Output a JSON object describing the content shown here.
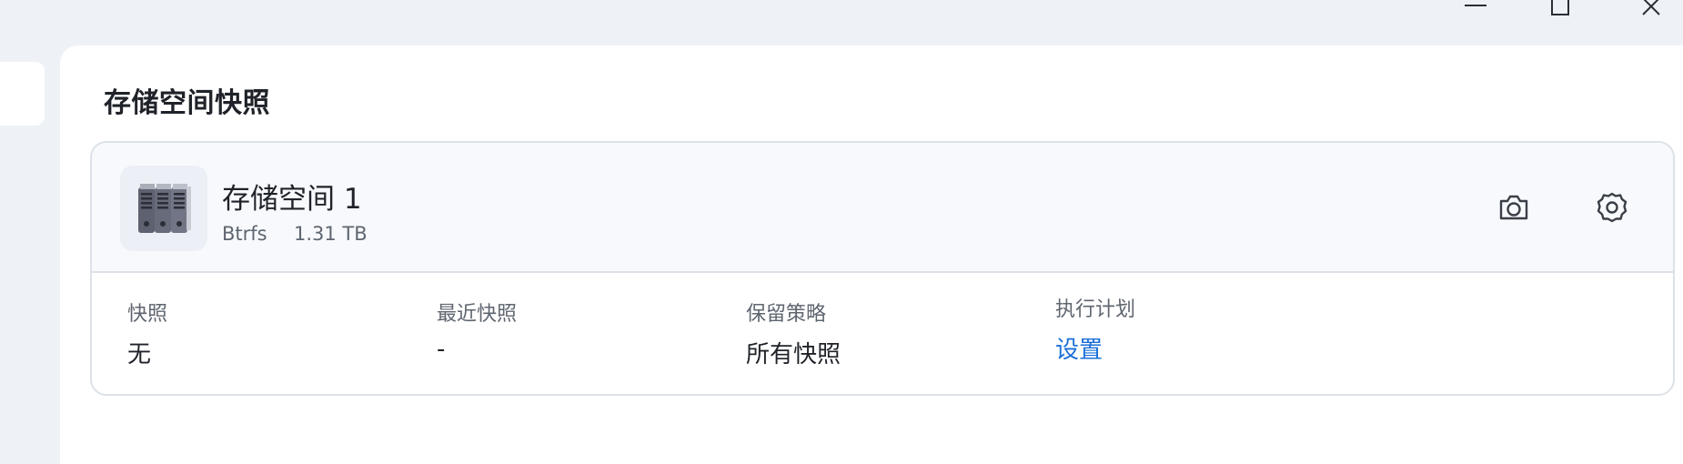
{
  "window": {
    "controls": [
      "minimize",
      "maximize",
      "close"
    ]
  },
  "page": {
    "title": "存储空间快照"
  },
  "volume": {
    "icon": "server-icon",
    "name": "存储空间 1",
    "filesystem": "Btrfs",
    "size": "1.31 TB",
    "actions": {
      "snapshot_icon": "camera-icon",
      "settings_icon": "gear-icon"
    }
  },
  "info": {
    "snapshots": {
      "label": "快照",
      "value": "无"
    },
    "latest": {
      "label": "最近快照",
      "value": "-"
    },
    "retention": {
      "label": "保留策略",
      "value": "所有快照"
    },
    "schedule": {
      "label": "执行计划",
      "value": "设置"
    }
  },
  "colors": {
    "link": "#1a6fd8",
    "background": "#eef2f7",
    "card_border": "#dde2e8"
  }
}
